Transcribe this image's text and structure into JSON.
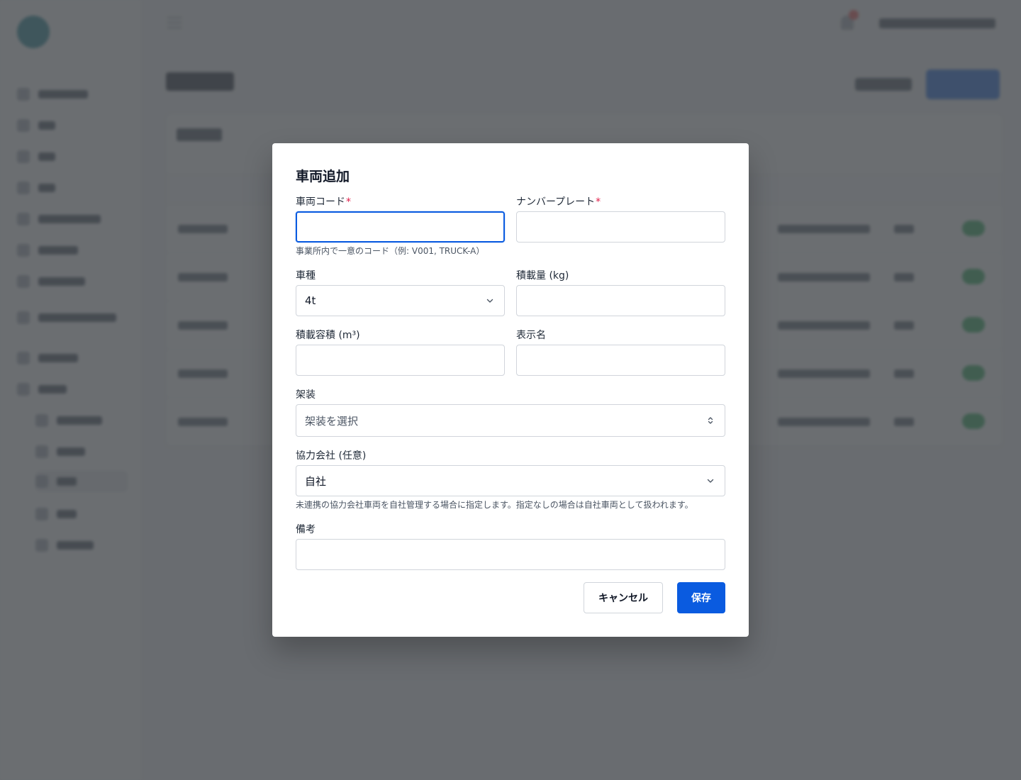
{
  "modal": {
    "title": "車両追加",
    "fields": {
      "vehicle_code": {
        "label": "車両コード",
        "required_mark": "*",
        "value": "",
        "help": "事業所内で一意のコード（例: V001, TRUCK-A）"
      },
      "number_plate": {
        "label": "ナンバープレート",
        "required_mark": "*",
        "value": ""
      },
      "vehicle_type": {
        "label": "車種",
        "selected": "4t"
      },
      "load_capacity": {
        "label": "積載量 (kg)",
        "value": ""
      },
      "load_volume": {
        "label": "積載容積 (m³)",
        "value": ""
      },
      "display_name": {
        "label": "表示名",
        "value": ""
      },
      "body_type": {
        "label": "架装",
        "placeholder": "架装を選択"
      },
      "partner_company": {
        "label": "協力会社 (任意)",
        "selected": "自社",
        "help": "未連携の協力会社車両を自社管理する場合に指定します。指定なしの場合は自社車両として扱われます。"
      },
      "notes": {
        "label": "備考",
        "value": ""
      }
    },
    "buttons": {
      "cancel": "キャンセル",
      "save": "保存"
    }
  },
  "colors": {
    "primary": "#0a5be0",
    "required": "#e11d48",
    "overlay": "#4b4e52"
  },
  "icons": {
    "select_chevron": "chevron-down-icon",
    "combobox_updown": "chevron-up-down-icon"
  }
}
